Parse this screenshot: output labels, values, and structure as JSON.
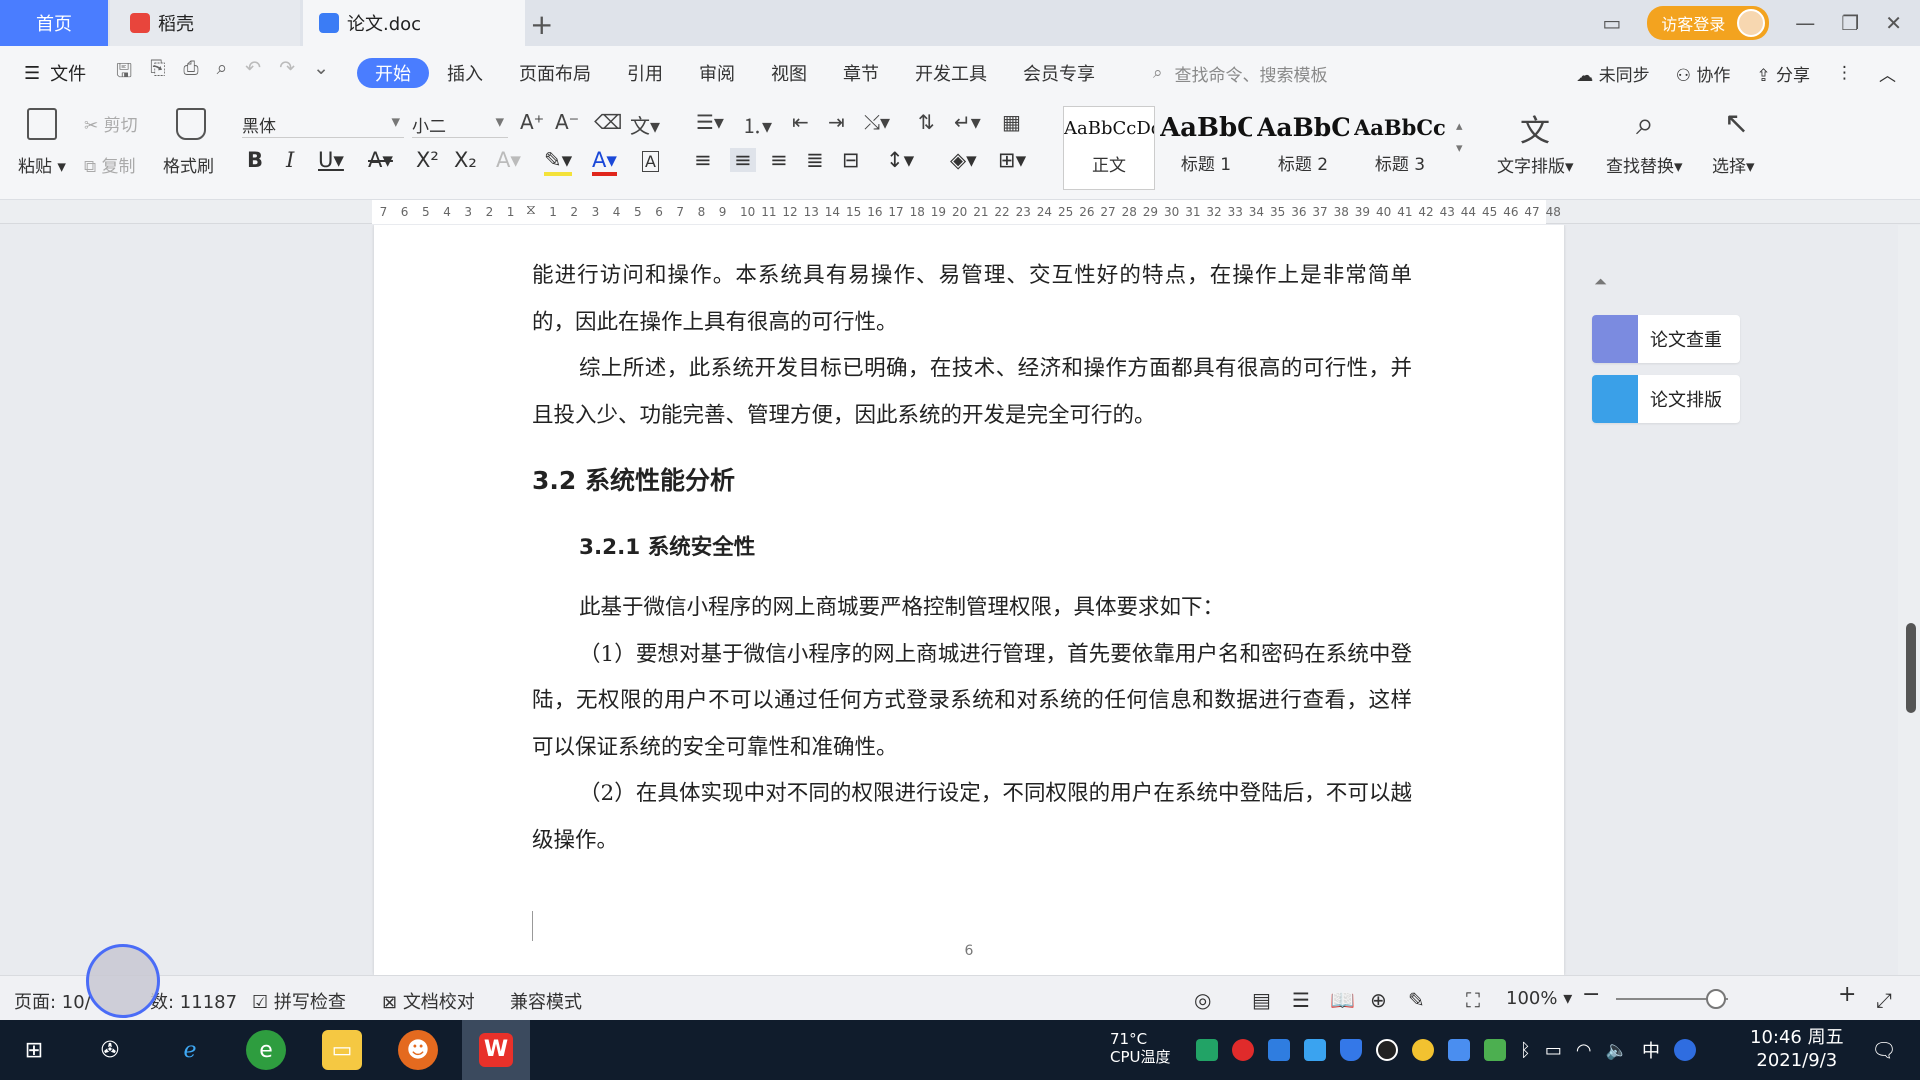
{
  "tabs": {
    "home": "首页",
    "daoke": "稻壳",
    "doc": "论文.doc",
    "add": "+"
  },
  "titlebar": {
    "login": "访客登录",
    "minimize": "—",
    "restore": "❐",
    "close": "✕"
  },
  "menu": {
    "file": "文件",
    "items": [
      "开始",
      "插入",
      "页面布局",
      "引用",
      "审阅",
      "视图",
      "章节",
      "开发工具",
      "会员专享"
    ],
    "search_command": "查找命令、搜索模板",
    "unsynced": "未同步",
    "collab": "协作",
    "share": "分享"
  },
  "ribbon": {
    "paste": "粘贴",
    "cut": "剪切",
    "copy": "复制",
    "format_painter": "格式刷",
    "font_name": "黑体",
    "font_size": "小二",
    "styles": [
      {
        "preview": "AaBbCcDd",
        "label": "正文"
      },
      {
        "preview": "AaBbC",
        "label": "标题 1"
      },
      {
        "preview": "AaBbC",
        "label": "标题 2"
      },
      {
        "preview": "AaBbCcI",
        "label": "标题 3"
      }
    ],
    "text_layout": "文字排版",
    "find_replace": "查找替换",
    "select": "选择"
  },
  "ruler": {
    "left_ticks": [
      "7",
      "6",
      "5",
      "4",
      "3",
      "2",
      "1"
    ],
    "right_ticks": [
      "1",
      "2",
      "3",
      "4",
      "5",
      "6",
      "7",
      "8",
      "9",
      "10",
      "11",
      "12",
      "13",
      "14",
      "15",
      "16",
      "17",
      "18",
      "19",
      "20",
      "21",
      "22",
      "23",
      "24",
      "25",
      "26",
      "27",
      "28",
      "29",
      "30",
      "31",
      "32",
      "33",
      "34",
      "35",
      "36",
      "37",
      "38",
      "39",
      "40",
      "41",
      "42",
      "43",
      "44",
      "45",
      "46",
      "47",
      "48"
    ]
  },
  "document": {
    "p1": "能进行访问和操作。本系统具有易操作、易管理、交互性好的特点，在操作上是非常简单的，因此在操作上具有很高的可行性。",
    "p2": "综上所述，此系统开发目标已明确，在技术、经济和操作方面都具有很高的可行性，并且投入少、功能完善、管理方便，因此系统的开发是完全可行的。",
    "h_3_2": "3.2 系统性能分析",
    "h_3_2_1": "3.2.1  系统安全性",
    "p3": "此基于微信小程序的网上商城要严格控制管理权限，具体要求如下：",
    "p4": "（1）要想对基于微信小程序的网上商城进行管理，首先要依靠用户名和密码在系统中登陆，无权限的用户不可以通过任何方式登录系统和对系统的任何信息和数据进行查看，这样可以保证系统的安全可靠性和准确性。",
    "p5": "（2）在具体实现中对不同的权限进行设定，不同权限的用户在系统中登陆后，不可以越级操作。",
    "page_number": "6"
  },
  "side_panel": {
    "check": "论文查重",
    "format": "论文排版"
  },
  "status": {
    "page": "页面: 10/",
    "words": "数: 11187",
    "spell": "拼写检查",
    "proof": "文档校对",
    "compat": "兼容模式",
    "zoom": "100%"
  },
  "taskbar": {
    "cpu_temp": "71°C",
    "cpu_label": "CPU温度",
    "ime": "中",
    "time": "10:46 周五",
    "date": "2021/9/3"
  },
  "colors": {
    "accent": "#4a7dff",
    "login": "#f3a31f",
    "taskbar": "#101c2c"
  }
}
